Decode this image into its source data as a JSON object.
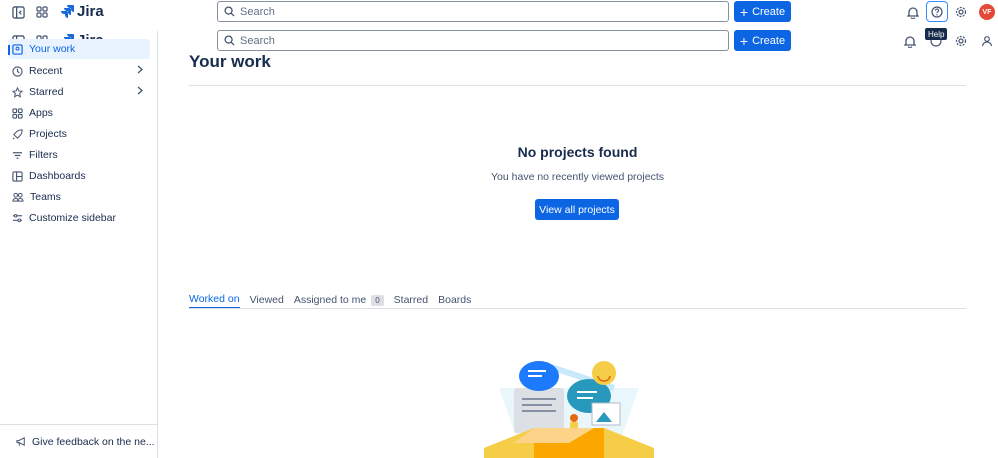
{
  "header": {
    "app_name": "Jira",
    "search_placeholder": "Search",
    "create_label": "Create",
    "avatar_initials": "VF",
    "help_tooltip": "Help"
  },
  "sidebar": {
    "items": [
      {
        "label": "Your work",
        "icon": "your-work-icon",
        "active": true
      },
      {
        "label": "Recent",
        "icon": "clock-icon",
        "has_chevron": true
      },
      {
        "label": "Starred",
        "icon": "star-icon",
        "has_chevron": true
      },
      {
        "label": "Apps",
        "icon": "apps-icon"
      },
      {
        "label": "Projects",
        "icon": "rocket-icon"
      },
      {
        "label": "Filters",
        "icon": "filter-icon"
      },
      {
        "label": "Dashboards",
        "icon": "dashboard-icon"
      },
      {
        "label": "Teams",
        "icon": "teams-icon"
      },
      {
        "label": "Customize sidebar",
        "icon": "customize-icon"
      }
    ],
    "feedback_label": "Give feedback on the ne..."
  },
  "main": {
    "title": "Your work",
    "empty_title": "No projects found",
    "empty_subtitle": "You have no recently viewed projects",
    "view_all_label": "View all projects",
    "tabs": [
      {
        "label": "Worked on",
        "active": true
      },
      {
        "label": "Viewed"
      },
      {
        "label": "Assigned to me",
        "count": "0"
      },
      {
        "label": "Starred"
      },
      {
        "label": "Boards"
      }
    ]
  },
  "colors": {
    "brand": "#0c66e4",
    "avatar": "#e34935"
  }
}
